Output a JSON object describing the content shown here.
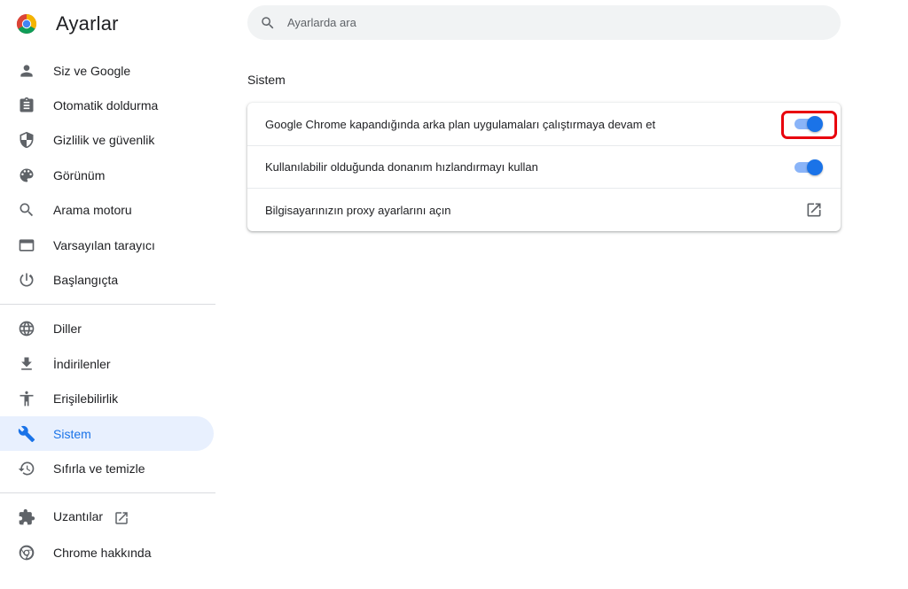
{
  "app": {
    "title": "Ayarlar",
    "logo_icon": "chrome-logo-icon"
  },
  "search": {
    "placeholder": "Ayarlarda ara",
    "icon": "search-icon"
  },
  "sidebar": {
    "items": [
      {
        "label": "Siz ve Google",
        "icon": "person-icon"
      },
      {
        "label": "Otomatik doldurma",
        "icon": "clipboard-icon"
      },
      {
        "label": "Gizlilik ve güvenlik",
        "icon": "shield-icon"
      },
      {
        "label": "Görünüm",
        "icon": "palette-icon"
      },
      {
        "label": "Arama motoru",
        "icon": "search-icon"
      },
      {
        "label": "Varsayılan tarayıcı",
        "icon": "browser-window-icon"
      },
      {
        "label": "Başlangıçta",
        "icon": "power-icon"
      },
      {
        "label": "Diller",
        "icon": "globe-icon"
      },
      {
        "label": "İndirilenler",
        "icon": "download-icon"
      },
      {
        "label": "Erişilebilirlik",
        "icon": "accessibility-icon"
      },
      {
        "label": "Sistem",
        "icon": "wrench-icon",
        "active": true
      },
      {
        "label": "Sıfırla ve temizle",
        "icon": "history-icon"
      },
      {
        "label": "Uzantılar",
        "icon": "puzzle-icon",
        "external_icon": "open-in-new-icon"
      },
      {
        "label": "Chrome hakkında",
        "icon": "chrome-icon"
      }
    ]
  },
  "main": {
    "section_title": "Sistem",
    "rows": [
      {
        "label": "Google Chrome kapandığında arka plan uygulamaları çalıştırmaya devam et",
        "control": "toggle",
        "checked": true,
        "highlighted": true
      },
      {
        "label": "Kullanılabilir olduğunda donanım hızlandırmayı kullan",
        "control": "toggle",
        "checked": true
      },
      {
        "label": "Bilgisayarınızın proxy ayarlarını açın",
        "control": "external-link",
        "icon": "open-in-new-icon"
      }
    ]
  },
  "colors": {
    "accent": "#1a73e8",
    "accent_light": "#8ab4f8",
    "active_nav_bg": "#e8f0fe",
    "highlight_border": "#e8000d",
    "search_bg": "#f1f3f4"
  }
}
